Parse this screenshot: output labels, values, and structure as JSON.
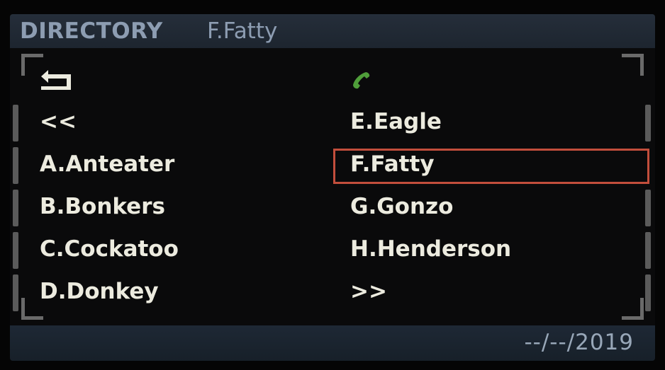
{
  "header": {
    "title": "DIRECTORY",
    "subtitle": "F.Fatty"
  },
  "left_column": {
    "back_icon": "return-arrow-icon",
    "prev_label": "<<",
    "entries": [
      "A.Anteater",
      "B.Bonkers",
      "C.Cockatoo",
      "D.Donkey"
    ]
  },
  "right_column": {
    "call_icon": "phone-handset-icon",
    "entries": [
      "E.Eagle",
      "F.Fatty",
      "G.Gonzo",
      "H.Henderson"
    ],
    "next_label": ">>",
    "selected": "F.Fatty"
  },
  "footer": {
    "date": "--/--/2019"
  },
  "colors": {
    "title": "#8d9db2",
    "text": "#ecebdf",
    "selection": "#c24e3c",
    "call_icon": "#4f9e3a",
    "date": "#98a7b8"
  }
}
